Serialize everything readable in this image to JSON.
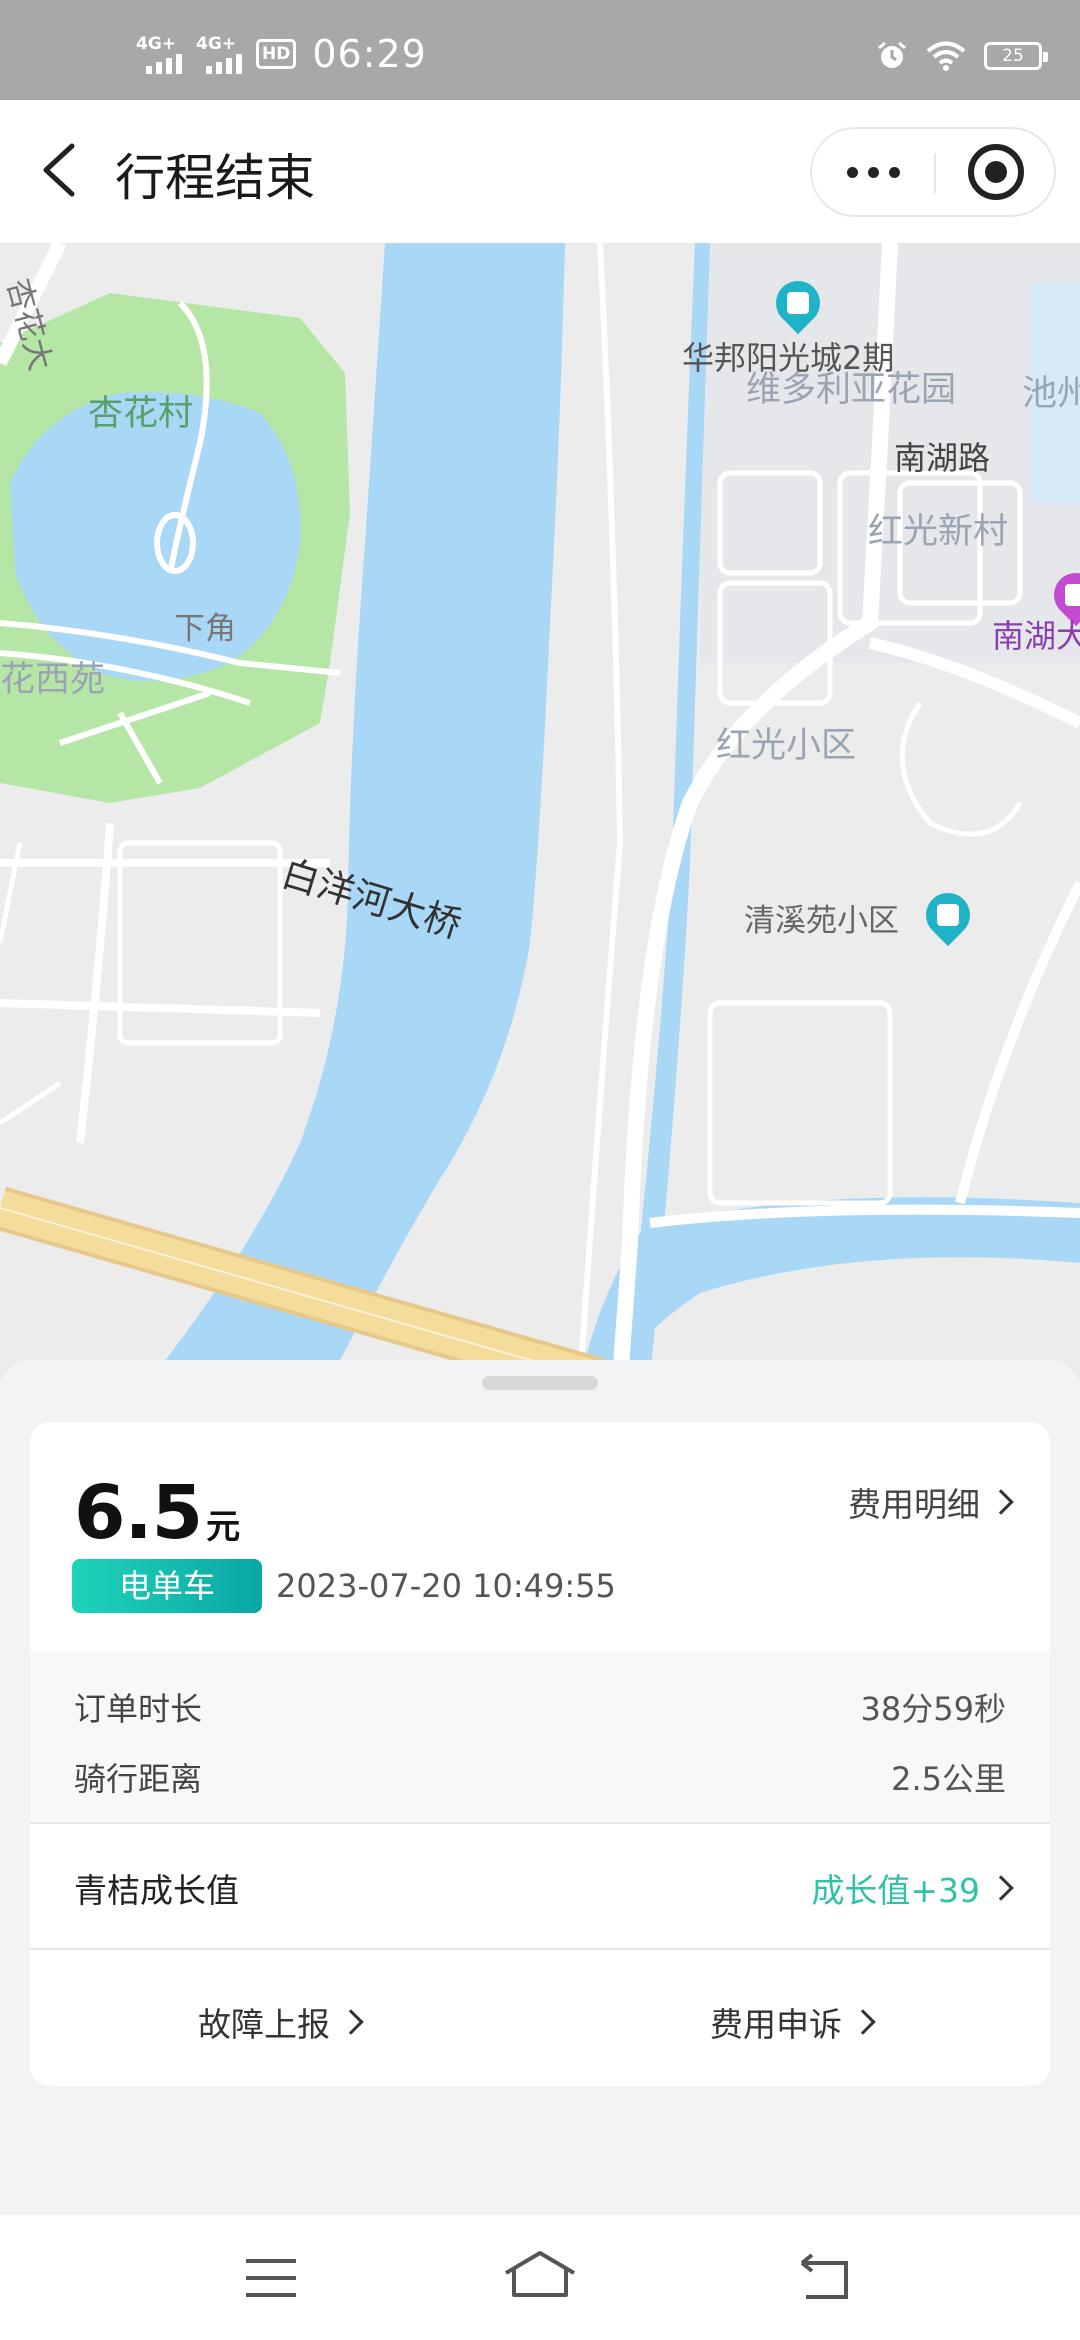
{
  "status_bar": {
    "signal1": "4G+",
    "signal2": "4G+",
    "hd": "HD",
    "time": "06:29",
    "battery": "25"
  },
  "header": {
    "title": "行程结束"
  },
  "map": {
    "labels": {
      "xinghua_road": "杏花大",
      "xinghua_village": "杏花村",
      "huabang": "华邦阳光城2期",
      "pond": "池州",
      "victoria": "维多利亚花园",
      "nanhu_road": "南湖路",
      "hongguang_new": "红光新村",
      "nanhu_da": "南湖大",
      "xiajiao": "下角",
      "huaxiyuan": "花西苑",
      "hongguang_xiaoqu": "红光小区",
      "bridge": "白洋河大桥",
      "qingxi": "清溪苑小区"
    }
  },
  "order": {
    "price": "6.5",
    "unit": "元",
    "fee_detail": "费用明细",
    "vehicle_tag": "电单车",
    "datetime": "2023-07-20 10:49:55",
    "duration_label": "订单时长",
    "duration_value": "38分59秒",
    "distance_label": "骑行距离",
    "distance_value": "2.5公里",
    "growth_label": "青桔成长值",
    "growth_value": "成长值+39",
    "report_fault": "故障上报",
    "fee_appeal": "费用申诉"
  },
  "colors": {
    "accent": "#2ec2a8",
    "river": "#a9d8f7",
    "park": "#b6e6a6",
    "road": "#ffffff",
    "bridge": "#f4dc9a"
  },
  "icons": [
    "back-arrow-icon",
    "more-dots-icon",
    "target-icon",
    "chevron-right-icon",
    "menu-icon",
    "home-icon",
    "back-icon"
  ]
}
